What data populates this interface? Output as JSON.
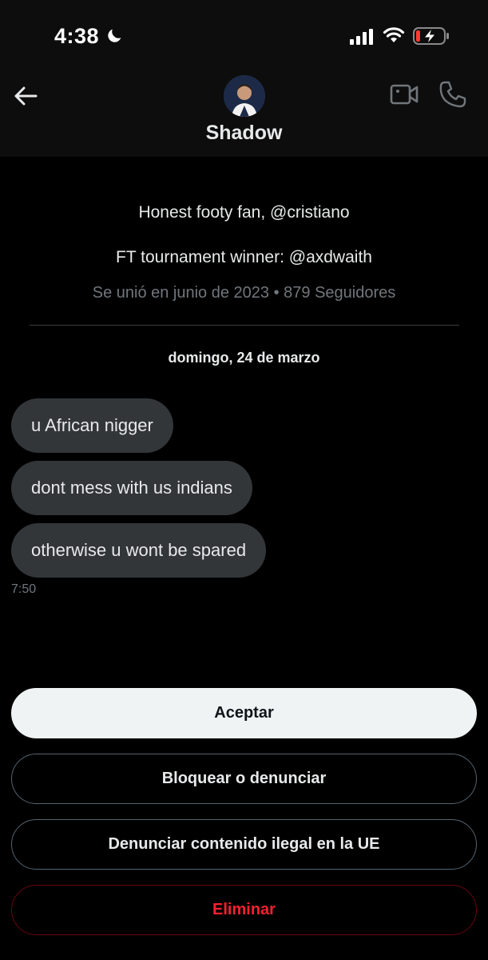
{
  "status": {
    "time": "4:38",
    "icons": [
      "moon-icon",
      "signal-icon",
      "wifi-icon",
      "battery-charging-icon"
    ]
  },
  "header": {
    "name": "Shadow",
    "icons": [
      "back-arrow-icon",
      "video-call-icon",
      "phone-call-icon"
    ]
  },
  "profile": {
    "bio_line1": "Honest footy fan, @cristiano",
    "bio_line2": "FT tournament winner: @axdwaith",
    "joined": "Se unió en junio de 2023 • 879 Seguidores"
  },
  "conversation": {
    "date": "domingo, 24 de marzo",
    "messages": [
      {
        "text": "u African nigger"
      },
      {
        "text": "dont mess with us indians"
      },
      {
        "text": "otherwise u wont be spared"
      }
    ],
    "time": "7:50"
  },
  "actions": {
    "accept": "Aceptar",
    "block_report": "Bloquear o denunciar",
    "report_illegal": "Denunciar contenido ilegal en la UE",
    "delete": "Eliminar"
  },
  "colors": {
    "background": "#000000",
    "bubble": "#333639",
    "muted_text": "#71767b",
    "danger": "#f4212e",
    "accept_bg": "#eff3f4"
  }
}
